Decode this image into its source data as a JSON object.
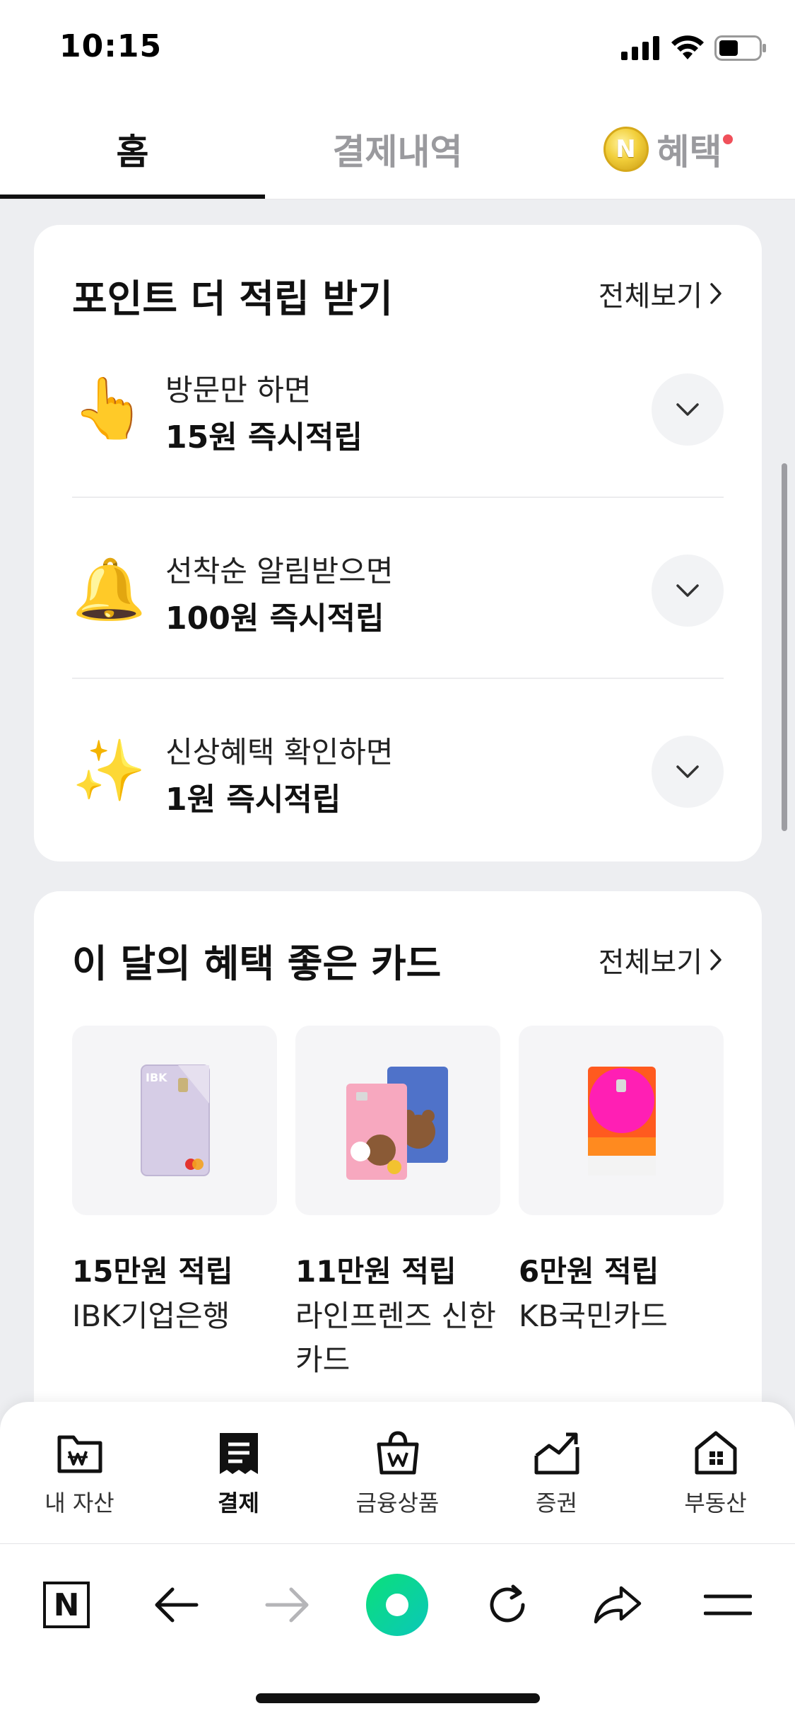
{
  "status_bar": {
    "time": "10:15"
  },
  "top_tabs": [
    {
      "label": "홈",
      "active": true
    },
    {
      "label": "결제내역",
      "active": false
    },
    {
      "label": "혜택",
      "active": false,
      "has_new_dot": true,
      "coin_glyph": "N"
    }
  ],
  "points_card": {
    "title": "포인트 더 적립 받기",
    "see_all": "전체보기",
    "items": [
      {
        "icon": "pointing-finger-icon",
        "emoji": "👆",
        "sub": "방문만 하면",
        "main": "15원 즉시적립"
      },
      {
        "icon": "bell-icon",
        "emoji": "🔔",
        "sub": "선착순 알림받으면",
        "main": "100원 즉시적립"
      },
      {
        "icon": "sparkles-icon",
        "emoji": "✨",
        "sub": "신상혜택 확인하면",
        "main": "1원 즉시적립"
      }
    ]
  },
  "cards_section": {
    "title": "이 달의 혜택 좋은 카드",
    "see_all": "전체보기",
    "products": [
      {
        "price": "15만원 적립",
        "name": "IBK기업은행",
        "card_text": "IBK"
      },
      {
        "price": "11만원 적립",
        "name": "라인프렌즈 신한카드"
      },
      {
        "price": "6만원 적립",
        "name": "KB국민카드"
      }
    ]
  },
  "app_nav": [
    {
      "label": "내 자산",
      "icon": "wallet-folder-icon",
      "active": false
    },
    {
      "label": "결제",
      "icon": "receipt-icon",
      "active": true
    },
    {
      "label": "금융상품",
      "icon": "shopping-bag-icon",
      "active": false
    },
    {
      "label": "증권",
      "icon": "chart-up-icon",
      "active": false
    },
    {
      "label": "부동산",
      "icon": "house-icon",
      "active": false
    }
  ],
  "browser_bar": {
    "logo_letter": "N",
    "tools": [
      "naver-home-icon",
      "back-icon",
      "forward-icon",
      "green-dot-icon",
      "reload-icon",
      "share-icon",
      "menu-icon"
    ]
  },
  "colors": {
    "accent_green": "#10d47a",
    "red_dot": "#f0505a",
    "background": "#edeef1"
  }
}
